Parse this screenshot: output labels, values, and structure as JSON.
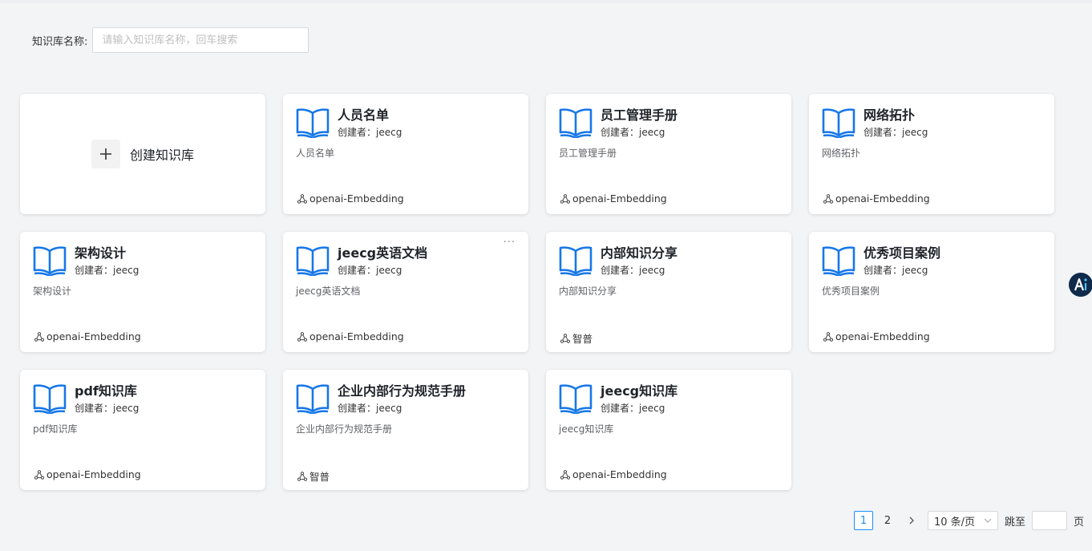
{
  "search": {
    "label": "知识库名称:",
    "placeholder": "请输入知识库名称，回车搜索",
    "value": ""
  },
  "create_card": {
    "label": "创建知识库"
  },
  "cards": [
    {
      "title": "人员名单",
      "creator": "创建者：jeecg",
      "description": "人员名单",
      "model": "openai-Embedding"
    },
    {
      "title": "员工管理手册",
      "creator": "创建者：jeecg",
      "description": "员工管理手册",
      "model": "openai-Embedding"
    },
    {
      "title": "网络拓扑",
      "creator": "创建者：jeecg",
      "description": "网络拓扑",
      "model": "openai-Embedding"
    },
    {
      "title": "架构设计",
      "creator": "创建者：jeecg",
      "description": "架构设计",
      "model": "openai-Embedding"
    },
    {
      "title": "jeecg英语文档",
      "creator": "创建者：jeecg",
      "description": "jeecg英语文档",
      "model": "openai-Embedding",
      "more": "···"
    },
    {
      "title": "内部知识分享",
      "creator": "创建者：jeecg",
      "description": "内部知识分享",
      "model": "智普"
    },
    {
      "title": "优秀项目案例",
      "creator": "创建者：jeecg",
      "description": "优秀项目案例",
      "model": "openai-Embedding"
    },
    {
      "title": "pdf知识库",
      "creator": "创建者：jeecg",
      "description": "pdf知识库",
      "model": "openai-Embedding"
    },
    {
      "title": "企业内部行为规范手册",
      "creator": "创建者：jeecg",
      "description": "企业内部行为规范手册",
      "model": "智普"
    },
    {
      "title": "jeecg知识库",
      "creator": "创建者：jeecg",
      "description": "jeecg知识库",
      "model": "openai-Embedding"
    }
  ],
  "pagination": {
    "pages": [
      "1",
      "2"
    ],
    "current": "1",
    "next": ">",
    "page_size": "10 条/页",
    "jump_label": "跳至",
    "page_suffix": "页"
  },
  "colors": {
    "accent": "#1890ff",
    "book_icon": "#1677e8",
    "fab_bg": "#0f2a4a"
  },
  "icons": {
    "book": "book-open-icon",
    "model": "network-nodes-icon",
    "create": "plus-icon",
    "fab": "ai-assistant-icon"
  }
}
